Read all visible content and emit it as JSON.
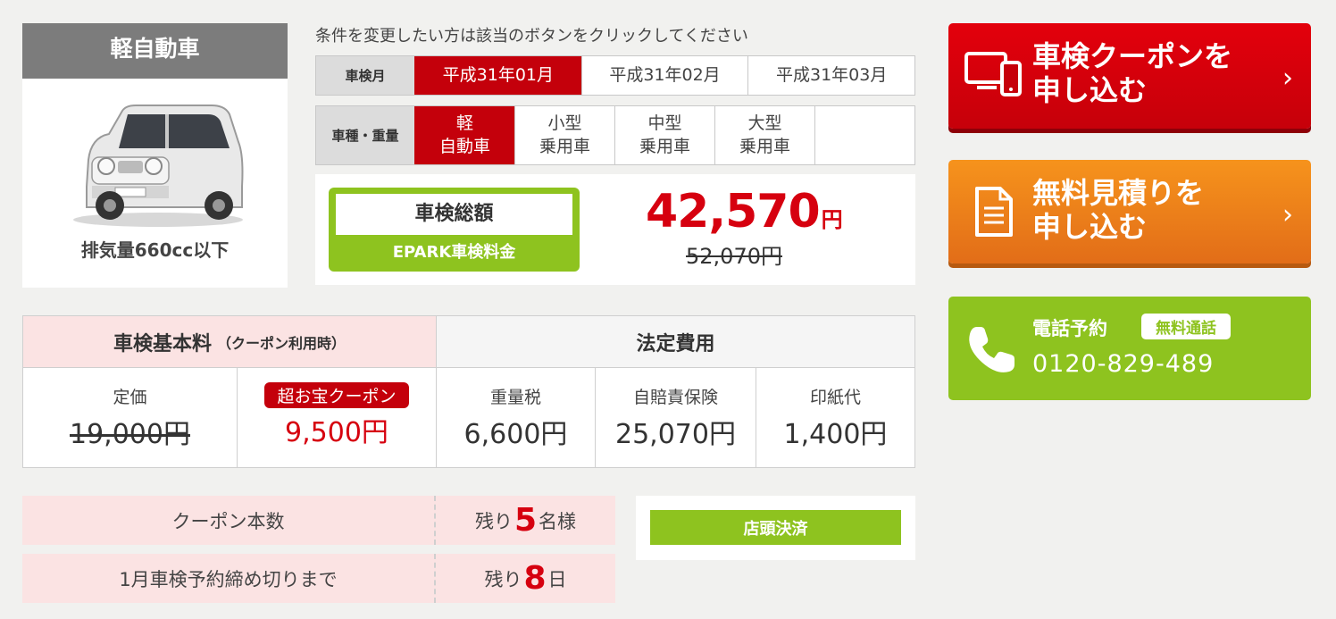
{
  "car": {
    "title": "軽自動車",
    "caption": "排気量660cc以下"
  },
  "selector": {
    "hint": "条件を変更したい方は該当のボタンをクリックしてください",
    "month_label": "車検月",
    "months": [
      "平成31年01月",
      "平成31年02月",
      "平成31年03月"
    ],
    "type_label": "車種・重量",
    "types": [
      {
        "line1": "軽",
        "line2": "自動車"
      },
      {
        "line1": "小型",
        "line2": "乗用車"
      },
      {
        "line1": "中型",
        "line2": "乗用車"
      },
      {
        "line1": "大型",
        "line2": "乗用車"
      }
    ]
  },
  "total": {
    "title": "車検総額",
    "sub": "EPARK車検料金",
    "price": "42,570",
    "unit": "円",
    "old_price": "52,070円"
  },
  "fees": {
    "basic_head": "車検基本料",
    "basic_note": "（クーポン利用時）",
    "legal_head": "法定費用",
    "list_label": "定価",
    "list_value": "19,000円",
    "coupon_tag": "超お宝クーポン",
    "coupon_value": "9,500円",
    "weight_tax_label": "重量税",
    "weight_tax_value": "6,600円",
    "insurance_label": "自賠責保険",
    "insurance_value": "25,070円",
    "stamp_label": "印紙代",
    "stamp_value": "1,400円"
  },
  "info": {
    "coupon_count_label": "クーポン本数",
    "remain_prefix": "残り",
    "coupon_count": "5",
    "coupon_unit": "名様",
    "deadline_label": "1月車検予約締め切りまで",
    "deadline_days": "8",
    "deadline_unit": "日",
    "payment": "店頭決済"
  },
  "cta": {
    "coupon_line1": "車検クーポンを",
    "coupon_line2": "申し込む",
    "estimate_line1": "無料見積りを",
    "estimate_line2": "申し込む",
    "tel_title": "電話予約",
    "tel_free": "無料通話",
    "tel_number": "0120-829-489",
    "arrow": "›"
  },
  "colors": {
    "accent_red": "#c4000b",
    "price_red": "#d6000f",
    "green": "#8ec31f",
    "orange": "#f08a1c"
  }
}
